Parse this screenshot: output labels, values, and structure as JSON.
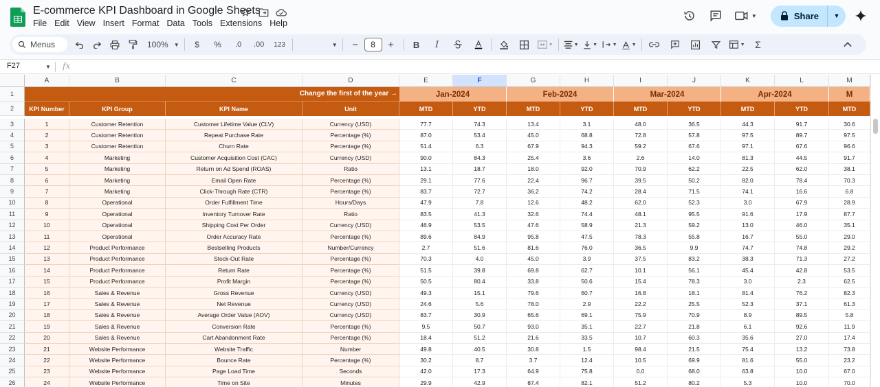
{
  "title": "E-commerce KPI Dashboard in Google Sheets",
  "menu": [
    "File",
    "Edit",
    "View",
    "Insert",
    "Format",
    "Data",
    "Tools",
    "Extensions",
    "Help"
  ],
  "share_label": "Share",
  "toolbar": {
    "menus_label": "Menus",
    "zoom": "100%",
    "currency": "$",
    "percent": "%",
    "decrease_decimal": ".0",
    "increase_decimal": ".00",
    "number_format": "123",
    "font_size": "8",
    "bold": "B",
    "italic": "I"
  },
  "name_box": "F27",
  "fx_label": "fx",
  "columns": [
    "A",
    "B",
    "C",
    "D",
    "E",
    "F",
    "G",
    "H",
    "I",
    "J",
    "K",
    "L",
    "M"
  ],
  "row_numbers": [
    "1",
    "2",
    "3",
    "4",
    "5",
    "6",
    "7",
    "8",
    "9",
    "10",
    "11",
    "12",
    "13",
    "14",
    "15",
    "16",
    "17",
    "18",
    "19",
    "20",
    "21",
    "22",
    "23",
    "24",
    "25",
    "26"
  ],
  "header_note": "Change the first of the year →",
  "months": [
    "Jan-2024",
    "Feb-2024",
    "Mar-2024",
    "Apr-2024",
    "M"
  ],
  "headers": [
    "KPI Number",
    "KPI Group",
    "KPI Name",
    "Unit",
    "MTD",
    "YTD",
    "MTD",
    "YTD",
    "MTD",
    "YTD",
    "MTD",
    "YTD",
    "MTD"
  ],
  "rows": [
    [
      "1",
      "Customer Retention",
      "Customer Lifetime Value (CLV)",
      "Currency (USD)",
      "77.7",
      "74.3",
      "13.4",
      "3.1",
      "48.0",
      "36.5",
      "44.3",
      "91.7",
      "30.6"
    ],
    [
      "2",
      "Customer Retention",
      "Repeat Purchase Rate",
      "Percentage (%)",
      "87.0",
      "53.4",
      "45.0",
      "68.8",
      "72.8",
      "57.8",
      "97.5",
      "89.7",
      "97.5"
    ],
    [
      "3",
      "Customer Retention",
      "Churn Rate",
      "Percentage (%)",
      "51.4",
      "6.3",
      "67.9",
      "94.3",
      "59.2",
      "67.6",
      "97.1",
      "67.6",
      "96.6"
    ],
    [
      "4",
      "Marketing",
      "Customer Acquisition Cost (CAC)",
      "Currency (USD)",
      "90.0",
      "84.3",
      "25.4",
      "3.6",
      "2.6",
      "14.0",
      "81.3",
      "44.5",
      "91.7"
    ],
    [
      "5",
      "Marketing",
      "Return on Ad Spend (ROAS)",
      "Ratio",
      "13.1",
      "18.7",
      "18.0",
      "92.0",
      "70.9",
      "62.2",
      "22.5",
      "62.0",
      "38.1"
    ],
    [
      "6",
      "Marketing",
      "Email Open Rate",
      "Percentage (%)",
      "29.1",
      "77.6",
      "22.4",
      "96.7",
      "39.5",
      "50.2",
      "82.0",
      "78.4",
      "70.3"
    ],
    [
      "7",
      "Marketing",
      "Click-Through Rate (CTR)",
      "Percentage (%)",
      "83.7",
      "72.7",
      "36.2",
      "74.2",
      "28.4",
      "71.5",
      "74.1",
      "16.6",
      "6.8"
    ],
    [
      "8",
      "Operational",
      "Order Fulfillment Time",
      "Hours/Days",
      "47.9",
      "7.8",
      "12.6",
      "48.2",
      "62.0",
      "52.3",
      "3.0",
      "67.9",
      "28.9"
    ],
    [
      "9",
      "Operational",
      "Inventory Turnover Rate",
      "Ratio",
      "83.5",
      "41.3",
      "32.6",
      "74.4",
      "48.1",
      "95.5",
      "91.6",
      "17.9",
      "87.7"
    ],
    [
      "10",
      "Operational",
      "Shipping Cost Per Order",
      "Currency (USD)",
      "46.9",
      "53.5",
      "47.6",
      "58.9",
      "21.3",
      "59.2",
      "13.0",
      "46.0",
      "35.1"
    ],
    [
      "11",
      "Operational",
      "Order Accuracy Rate",
      "Percentage (%)",
      "89.6",
      "84.9",
      "95.8",
      "47.5",
      "78.3",
      "55.8",
      "16.7",
      "55.0",
      "29.0"
    ],
    [
      "12",
      "Product Performance",
      "Bestselling Products",
      "Number/Currency",
      "2.7",
      "51.6",
      "81.6",
      "76.0",
      "36.5",
      "9.9",
      "74.7",
      "74.8",
      "29.2"
    ],
    [
      "13",
      "Product Performance",
      "Stock-Out Rate",
      "Percentage (%)",
      "70.3",
      "4.0",
      "45.0",
      "3.9",
      "37.5",
      "83.2",
      "38.3",
      "71.3",
      "27.2"
    ],
    [
      "14",
      "Product Performance",
      "Return Rate",
      "Percentage (%)",
      "51.5",
      "39.8",
      "69.8",
      "62.7",
      "10.1",
      "56.1",
      "45.4",
      "42.8",
      "53.5"
    ],
    [
      "15",
      "Product Performance",
      "Profit Margin",
      "Percentage (%)",
      "50.5",
      "80.4",
      "33.8",
      "50.6",
      "15.4",
      "78.3",
      "3.0",
      "2.3",
      "62.5"
    ],
    [
      "16",
      "Sales & Revenue",
      "Gross Revenue",
      "Currency (USD)",
      "49.3",
      "15.1",
      "79.6",
      "60.7",
      "16.8",
      "18.1",
      "81.4",
      "76.2",
      "82.3"
    ],
    [
      "17",
      "Sales & Revenue",
      "Net Revenue",
      "Currency (USD)",
      "24.6",
      "5.6",
      "78.0",
      "2.9",
      "22.2",
      "25.5",
      "52.3",
      "37.1",
      "61.3"
    ],
    [
      "18",
      "Sales & Revenue",
      "Average Order Value (AOV)",
      "Currency (USD)",
      "83.7",
      "30.9",
      "65.6",
      "69.1",
      "75.9",
      "70.9",
      "8.9",
      "89.5",
      "5.8"
    ],
    [
      "19",
      "Sales & Revenue",
      "Conversion Rate",
      "Percentage (%)",
      "9.5",
      "50.7",
      "93.0",
      "35.1",
      "22.7",
      "21.8",
      "6.1",
      "92.6",
      "11.9"
    ],
    [
      "20",
      "Sales & Revenue",
      "Cart Abandonment Rate",
      "Percentage (%)",
      "18.4",
      "51.2",
      "21.6",
      "33.5",
      "10.7",
      "60.3",
      "35.6",
      "27.0",
      "17.4"
    ],
    [
      "21",
      "Website Performance",
      "Website Traffic",
      "Number",
      "49.8",
      "40.5",
      "30.8",
      "1.5",
      "98.4",
      "21.5",
      "75.4",
      "13.2",
      "73.8"
    ],
    [
      "22",
      "Website Performance",
      "Bounce Rate",
      "Percentage (%)",
      "30.2",
      "8.7",
      "3.7",
      "12.4",
      "10.5",
      "69.9",
      "81.6",
      "55.0",
      "23.2"
    ],
    [
      "23",
      "Website Performance",
      "Page Load Time",
      "Seconds",
      "42.0",
      "17.3",
      "64.9",
      "75.8",
      "0.0",
      "68.0",
      "63.8",
      "10.0",
      "67.0"
    ],
    [
      "24",
      "Website Performance",
      "Time on Site",
      "Minutes",
      "29.9",
      "42.9",
      "87.4",
      "82.1",
      "51.2",
      "80.2",
      "5.3",
      "10.0",
      "70.0"
    ]
  ]
}
